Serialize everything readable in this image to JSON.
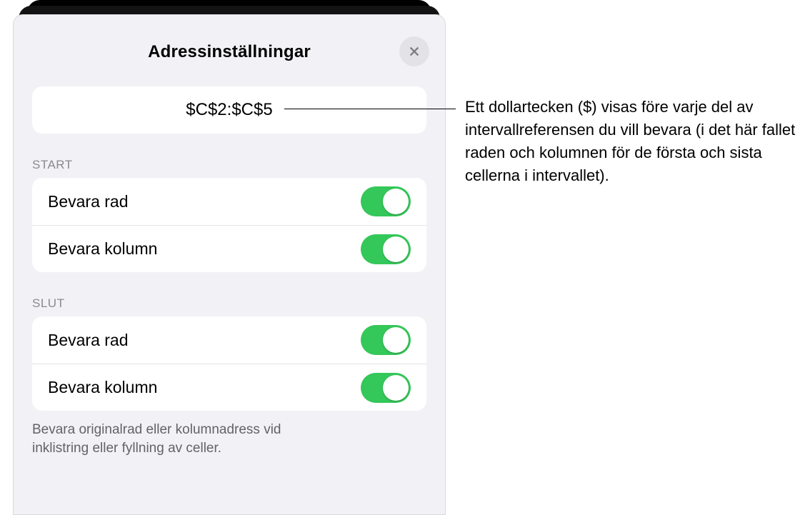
{
  "sheet": {
    "title": "Adressinställningar",
    "formula": "$C$2:$C$5",
    "start_label": "START",
    "slut_label": "SLUT",
    "rows": {
      "start_preserve_row": "Bevara rad",
      "start_preserve_col": "Bevara kolumn",
      "end_preserve_row": "Bevara rad",
      "end_preserve_col": "Bevara kolumn"
    },
    "footer": "Bevara originalrad eller kolumnadress vid inklistring eller fyllning av celler."
  },
  "callout": "Ett dollartecken ($) visas före varje del av intervallreferensen du vill bevara (i det här fallet raden och kolumnen för de första och sista cellerna i intervallet)."
}
